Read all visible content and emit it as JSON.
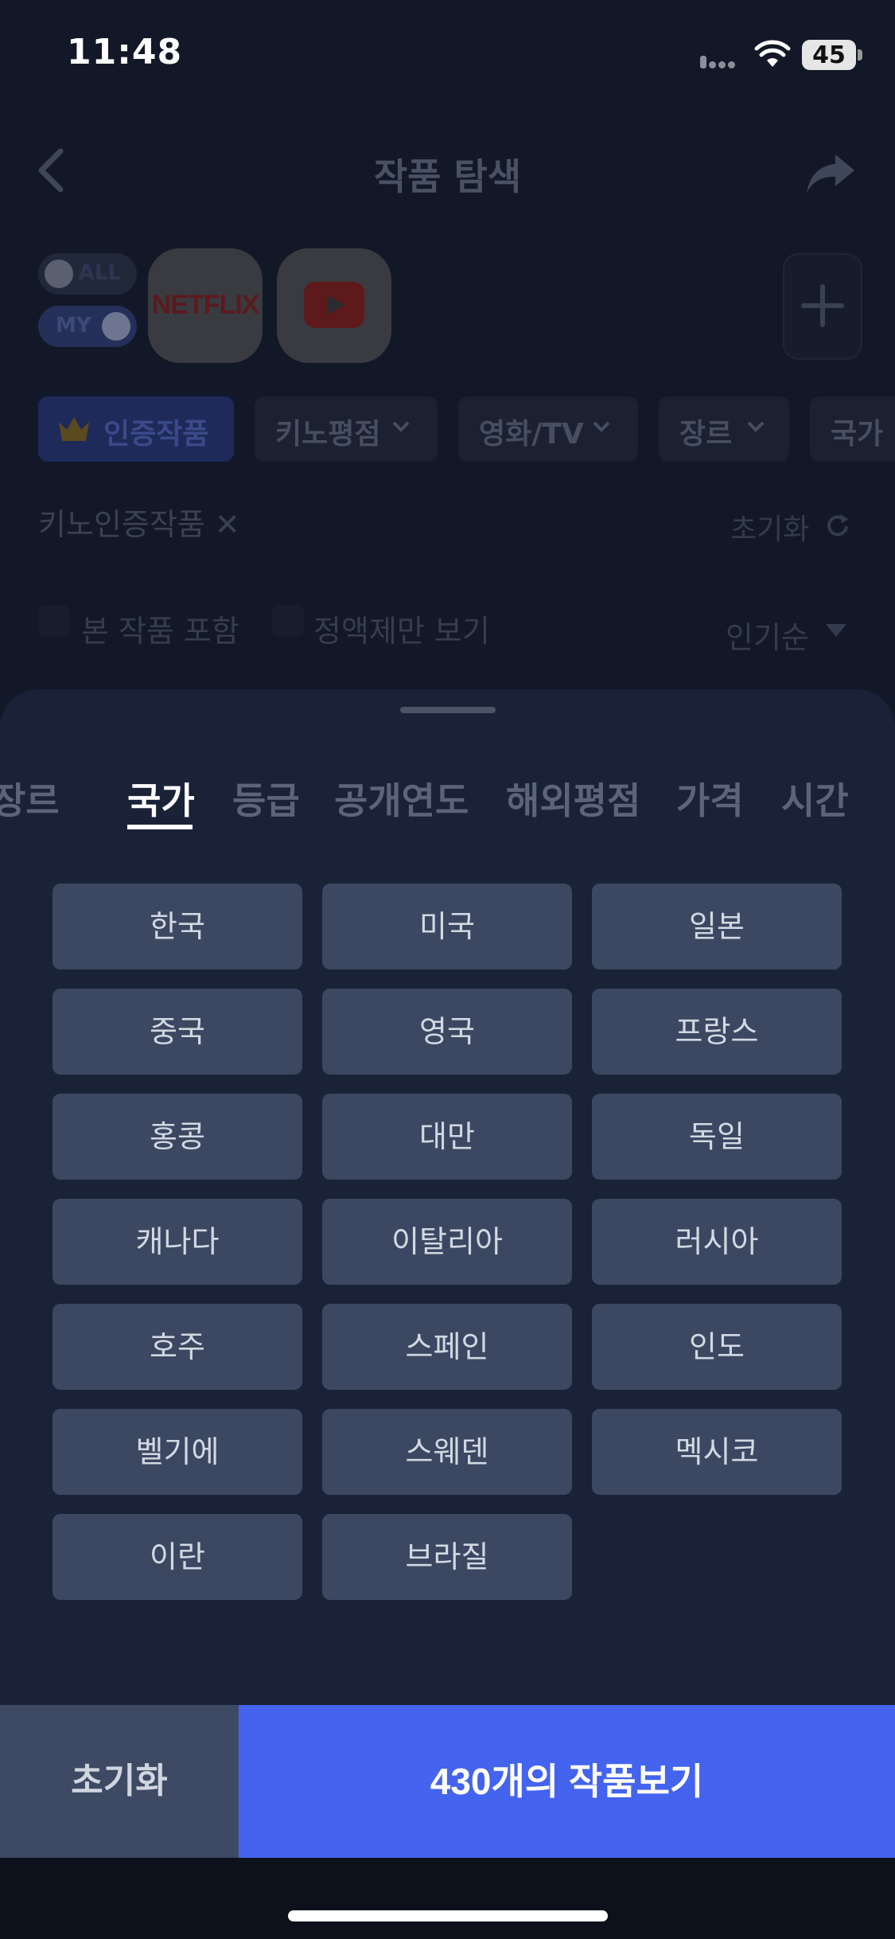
{
  "status": {
    "time": "11:48",
    "battery": "45"
  },
  "header": {
    "title": "작품 탐색"
  },
  "toggles": {
    "top_label": "ALL",
    "bottom_label": "MY"
  },
  "ott": {
    "netflix_label": "NETFLIX"
  },
  "chips": [
    {
      "label": "인증작품"
    },
    {
      "label": "키노평점"
    },
    {
      "label": "영화/TV"
    },
    {
      "label": "장르"
    },
    {
      "label": "국가"
    }
  ],
  "filters": {
    "active_tag": "키노인증작품 ✕",
    "reset_label": "초기화",
    "include_watched": "본 작품 포함",
    "flat_rate_only": "정액제만 보기",
    "sort_label": "인기순"
  },
  "sheet": {
    "tabs": [
      "장르",
      "국가",
      "등급",
      "공개연도",
      "해외평점",
      "가격",
      "시간"
    ],
    "active_tab": "국가",
    "options": [
      "한국",
      "미국",
      "일본",
      "중국",
      "영국",
      "프랑스",
      "홍콩",
      "대만",
      "독일",
      "캐나다",
      "이탈리아",
      "러시아",
      "호주",
      "스페인",
      "인도",
      "벨기에",
      "스웨덴",
      "멕시코",
      "이란",
      "브라질"
    ]
  },
  "actions": {
    "reset_label": "초기화",
    "view_label": "430개의 작품보기"
  },
  "colors": {
    "accent": "#4463ee",
    "option_bg": "#3c4862",
    "sheet_bg": "#1a2237"
  }
}
